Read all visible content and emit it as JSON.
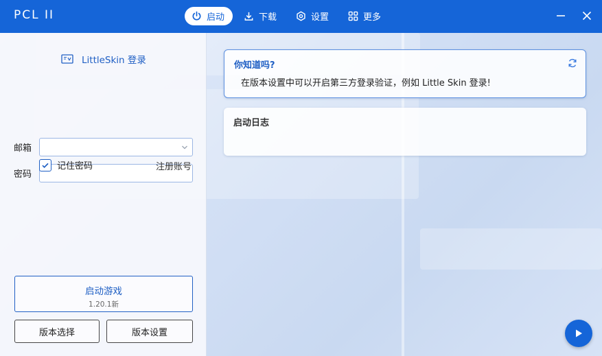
{
  "app": {
    "title": "PCL II"
  },
  "nav": [
    {
      "label": "启动",
      "icon": "power-icon",
      "active": true
    },
    {
      "label": "下载",
      "icon": "download-icon",
      "active": false
    },
    {
      "label": "设置",
      "icon": "settings-icon",
      "active": false
    },
    {
      "label": "更多",
      "icon": "grid-icon",
      "active": false
    }
  ],
  "window_controls": {
    "minimize_icon": "minimize-icon",
    "close_icon": "close-icon"
  },
  "login": {
    "type_label": "LittleSkin 登录",
    "email_label": "邮箱",
    "email_value": "",
    "password_label": "密码",
    "password_value": "",
    "remember_label": "记住密码",
    "remember_checked": true,
    "register_label": "注册账号"
  },
  "actions": {
    "launch_label": "启动游戏",
    "launch_version": "1.20.1新",
    "version_select": "版本选择",
    "version_settings": "版本设置"
  },
  "tip_card": {
    "title": "你知道吗?",
    "text": "在版本设置中可以开启第三方登录验证，例如 Little Skin 登录!"
  },
  "log_card": {
    "title": "启动日志"
  },
  "colors": {
    "accent": "#1565d8",
    "link": "#1f5fc4"
  }
}
